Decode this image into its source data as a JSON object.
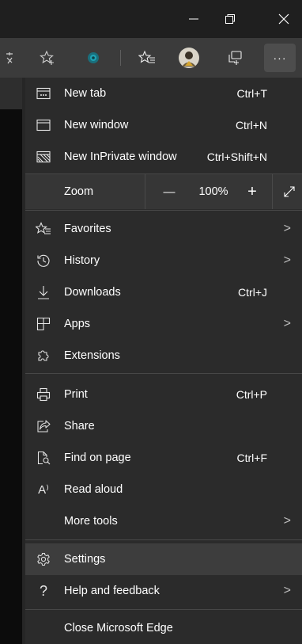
{
  "window": {
    "minimize_icon": "minimize-icon",
    "restore_icon": "restore-icon",
    "close_icon": "close-icon"
  },
  "toolbar": {
    "icons": [
      "translate-icon",
      "add-favorite-icon",
      "extension-icon",
      "favorites-icon",
      "profile-avatar",
      "collections-icon",
      "more-icon"
    ],
    "more_label": "···"
  },
  "menu": {
    "items_top": [
      {
        "label": "New tab",
        "shortcut": "Ctrl+T",
        "icon": "new-tab-icon"
      },
      {
        "label": "New window",
        "shortcut": "Ctrl+N",
        "icon": "new-window-icon"
      },
      {
        "label": "New InPrivate window",
        "shortcut": "Ctrl+Shift+N",
        "icon": "inprivate-icon"
      }
    ],
    "zoom": {
      "label": "Zoom",
      "minus": "—",
      "value": "100%",
      "plus": "+",
      "fullscreen_icon": "fullscreen-icon"
    },
    "items_mid": [
      {
        "label": "Favorites",
        "shortcut": "",
        "icon": "favorites-icon",
        "submenu": true
      },
      {
        "label": "History",
        "shortcut": "",
        "icon": "history-icon",
        "submenu": true
      },
      {
        "label": "Downloads",
        "shortcut": "Ctrl+J",
        "icon": "download-icon",
        "submenu": false
      },
      {
        "label": "Apps",
        "shortcut": "",
        "icon": "apps-icon",
        "submenu": true
      },
      {
        "label": "Extensions",
        "shortcut": "",
        "icon": "extensions-icon",
        "submenu": false
      }
    ],
    "items_tools": [
      {
        "label": "Print",
        "shortcut": "Ctrl+P",
        "icon": "print-icon"
      },
      {
        "label": "Share",
        "shortcut": "",
        "icon": "share-icon"
      },
      {
        "label": "Find on page",
        "shortcut": "Ctrl+F",
        "icon": "find-icon"
      },
      {
        "label": "Read aloud",
        "shortcut": "",
        "icon": "read-aloud-icon",
        "icon_text": "A⁾"
      },
      {
        "label": "More tools",
        "shortcut": "",
        "icon": "",
        "submenu": true
      }
    ],
    "items_bottom": [
      {
        "label": "Settings",
        "icon": "settings-icon",
        "highlighted": true
      },
      {
        "label": "Help and feedback",
        "icon": "help-icon",
        "icon_text": "?",
        "submenu": true
      }
    ],
    "close_label": "Close Microsoft Edge",
    "chevron": ">"
  },
  "colors": {
    "menu_bg": "#2b2b2b",
    "highlight": "#3d3d3d",
    "toolbar_bg": "#3b3b3b",
    "extension_accent": "#1fa3b5"
  }
}
